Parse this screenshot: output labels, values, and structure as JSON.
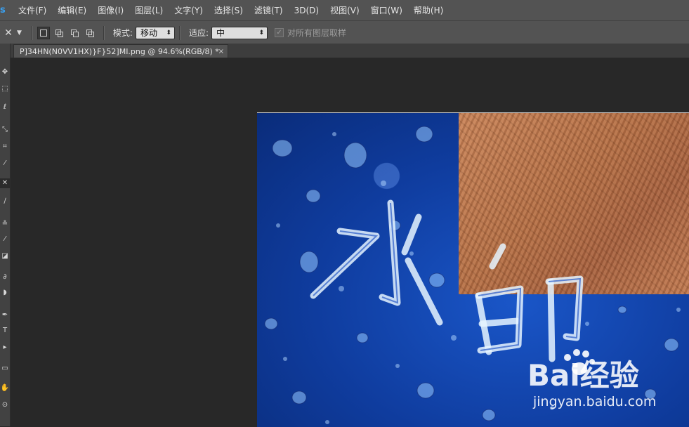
{
  "menubar": {
    "logo": "s",
    "items": [
      "文件(F)",
      "编辑(E)",
      "图像(I)",
      "图层(L)",
      "文字(Y)",
      "选择(S)",
      "滤镜(T)",
      "3D(D)",
      "视图(V)",
      "窗口(W)",
      "帮助(H)"
    ]
  },
  "options": {
    "mode_label": "模式:",
    "mode_value": "移动",
    "adapt_label": "适应:",
    "adapt_value": "中",
    "sample_all_label": "对所有图层取样",
    "sample_all_checked": true
  },
  "document": {
    "tab_title": "P]34HN(N0VV1HX)}F}52]MI.png @ 94.6%(RGB/8) *",
    "close_glyph": "×"
  },
  "image_content": {
    "watermark_chars": "水印",
    "brand_text": "Bai经验",
    "brand_url": "jingyan.baidu.com"
  },
  "colors": {
    "water_blue": "#1a56c8",
    "sand": "#b46f46",
    "ui_panel": "#535353",
    "ui_dark": "#282828"
  },
  "icons": {
    "tool_preset": "content-aware-move-icon",
    "mode_buttons": [
      "new-selection-icon",
      "add-selection-icon",
      "subtract-selection-icon",
      "intersect-selection-icon"
    ]
  }
}
